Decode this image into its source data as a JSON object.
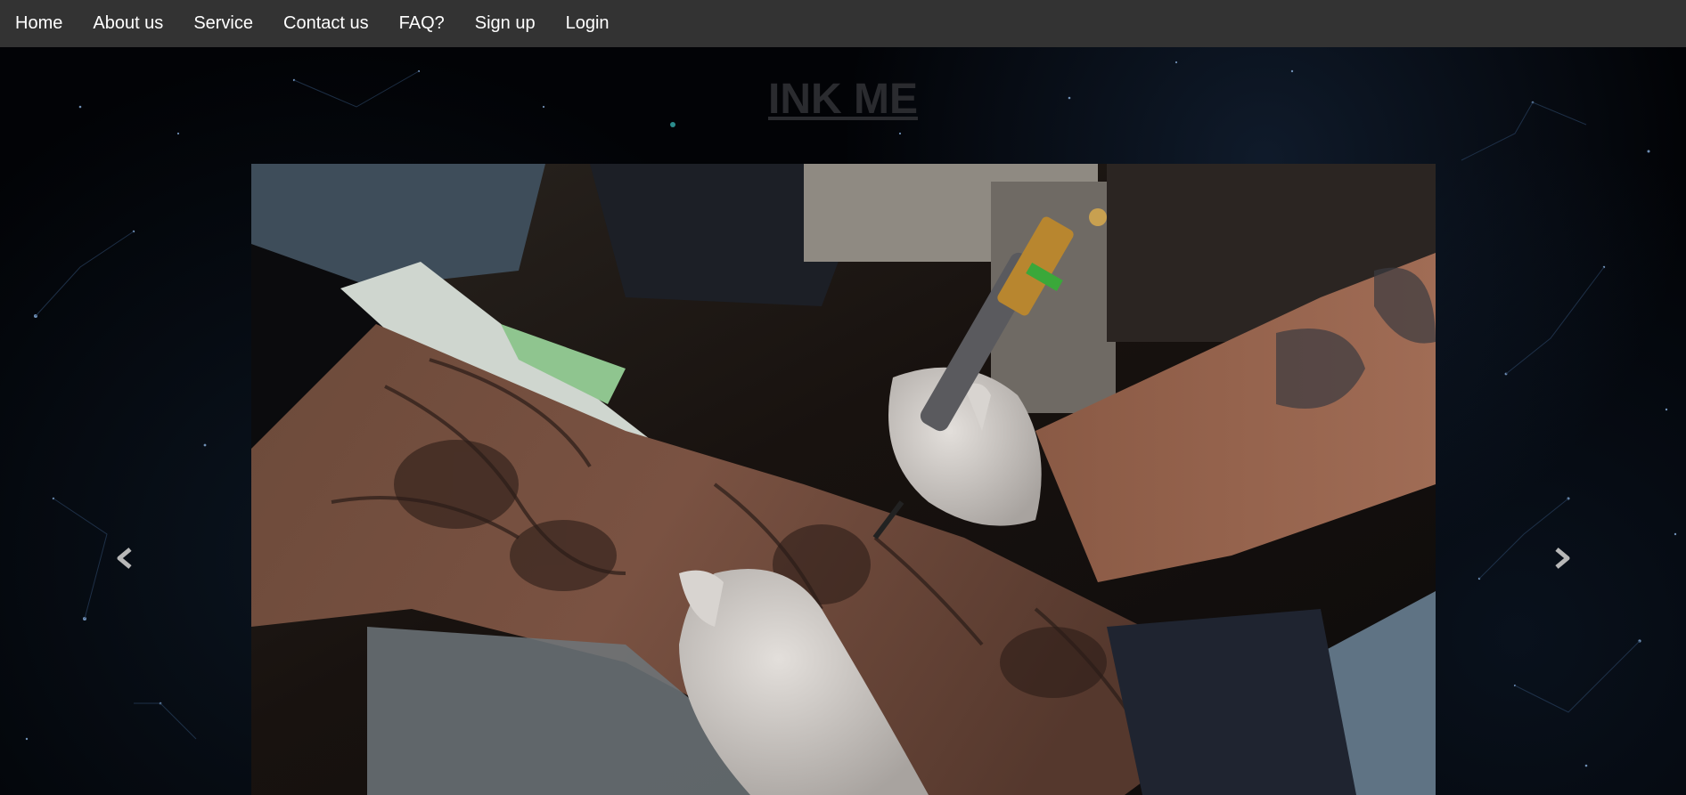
{
  "nav": {
    "items": [
      {
        "label": "Home"
      },
      {
        "label": "About us"
      },
      {
        "label": "Service"
      },
      {
        "label": "Contact us"
      },
      {
        "label": "FAQ?"
      },
      {
        "label": "Sign up"
      },
      {
        "label": "Login"
      }
    ]
  },
  "header": {
    "title": "INK ME"
  },
  "carousel": {
    "image_subject": "tattoo artist inking a forearm sleeve",
    "prev_icon": "chevron-left-icon",
    "next_icon": "chevron-right-icon"
  },
  "colors": {
    "nav_bg": "#333333",
    "nav_text": "#ffffff",
    "title": "#2a2b2f",
    "page_bg": "#020306"
  }
}
